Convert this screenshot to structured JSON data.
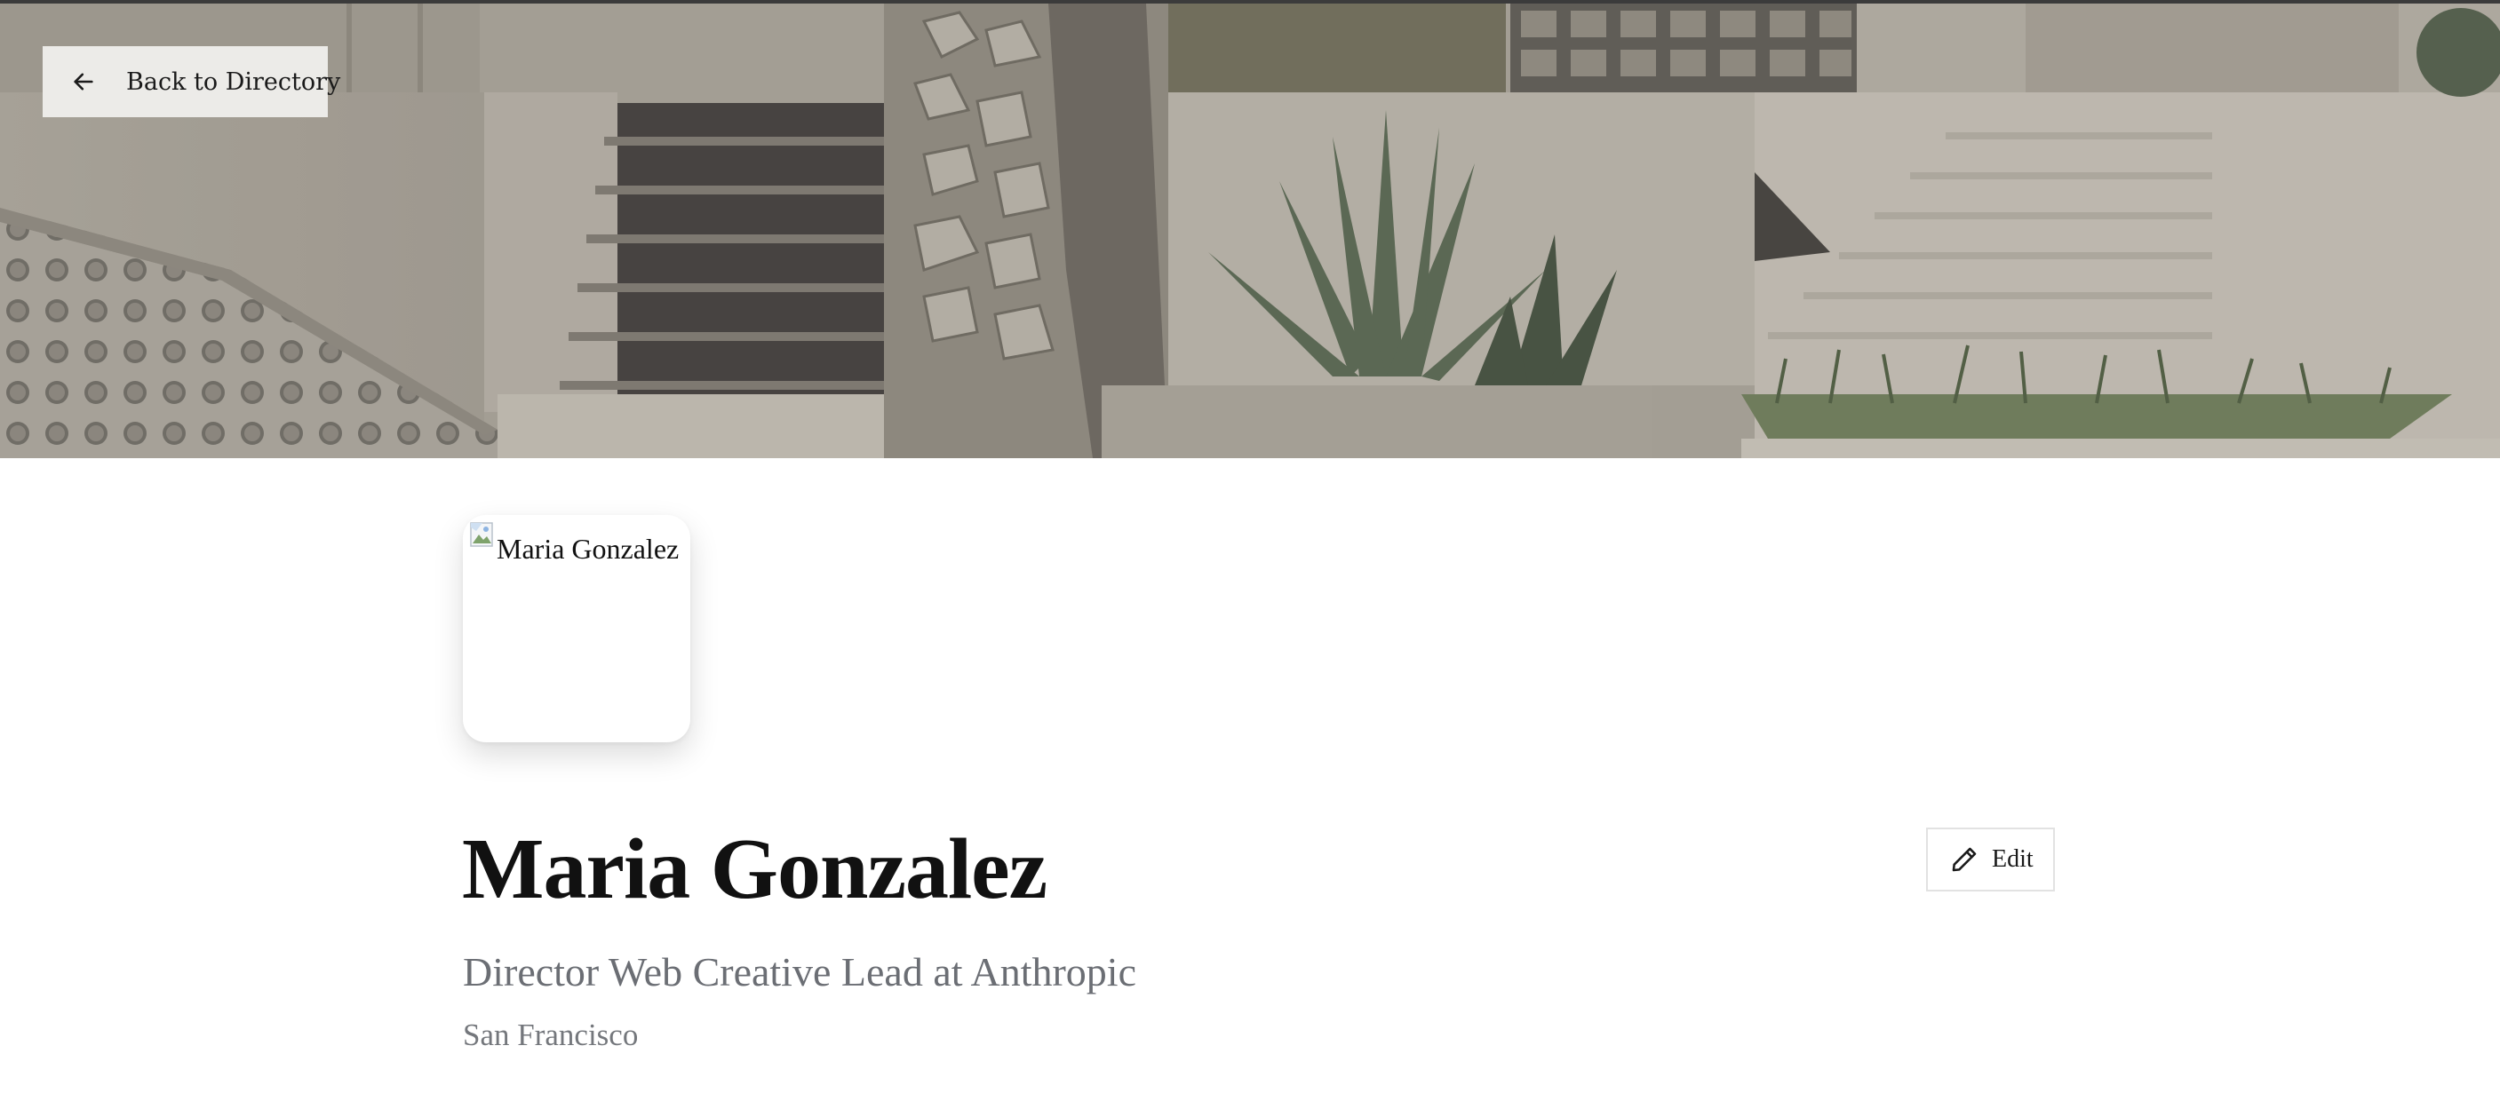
{
  "header": {
    "back_label": "Back to Directory",
    "back_icon": "arrow-left-icon",
    "cover_image": "concrete-stairs-garden-cover"
  },
  "profile": {
    "avatar_alt": "Maria Gonzalez",
    "name": "Maria Gonzalez",
    "title": "Director Web Creative Lead at Anthropic",
    "location": "San Francisco"
  },
  "actions": {
    "edit_label": "Edit",
    "edit_icon": "pencil-icon"
  },
  "colors": {
    "name_text": "#111111",
    "muted_text": "#6b6e74",
    "back_button_bg": "#ecebe8"
  }
}
